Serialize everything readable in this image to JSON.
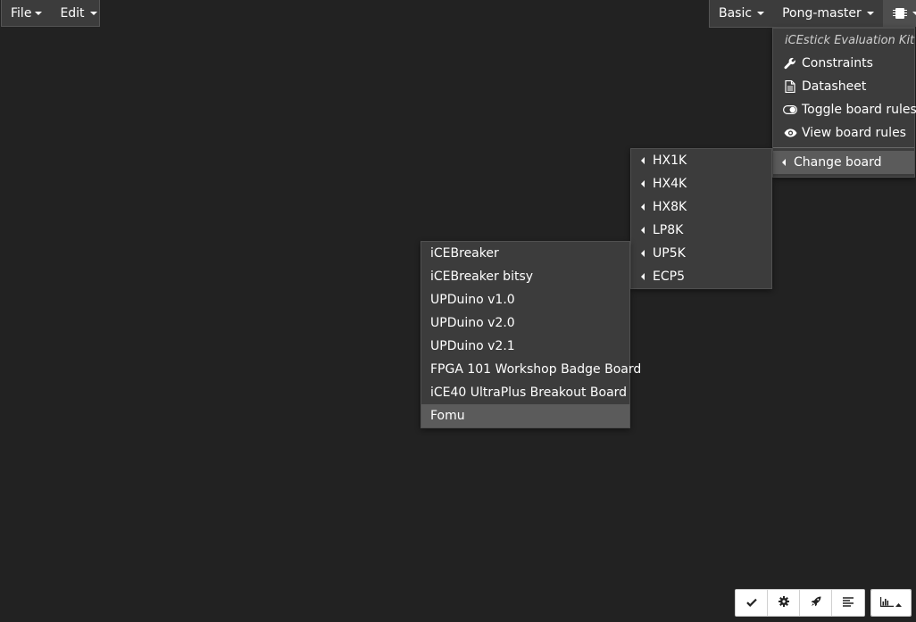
{
  "menubar_left": {
    "file_label": "File",
    "edit_label": "Edit"
  },
  "menubar_right": {
    "mode_label": "Basic",
    "project_label": "Pong-master",
    "board_icon": "chip-icon"
  },
  "board_menu": {
    "header": "iCEstick Evaluation Kit",
    "items": [
      {
        "label": "Constraints",
        "icon": "wrench-icon"
      },
      {
        "label": "Datasheet",
        "icon": "document-icon"
      },
      {
        "label": "Toggle board rules",
        "icon": "toggle-icon"
      },
      {
        "label": "View board rules",
        "icon": "eye-icon"
      }
    ],
    "change_board_label": "Change board"
  },
  "family_menu": {
    "items": [
      "HX1K",
      "HX4K",
      "HX8K",
      "LP8K",
      "UP5K",
      "ECP5"
    ]
  },
  "up5k_menu": {
    "items": [
      "iCEBreaker",
      "iCEBreaker bitsy",
      "UPDuino v1.0",
      "UPDuino v2.0",
      "UPDuino v2.1",
      "FPGA 101 Workshop Badge Board",
      "iCE40 UltraPlus Breakout Board",
      "Fomu"
    ],
    "highlighted": "Fomu"
  },
  "toolbar": {
    "buttons": [
      "check-icon",
      "gear-icon",
      "rocket-icon",
      "align-left-icon"
    ],
    "stats_button": "bar-chart-icon"
  },
  "colors": {
    "background": "#222222",
    "menu_background": "#3c3c3c",
    "highlight": "#5b5b5b",
    "text": "#ffffff"
  }
}
